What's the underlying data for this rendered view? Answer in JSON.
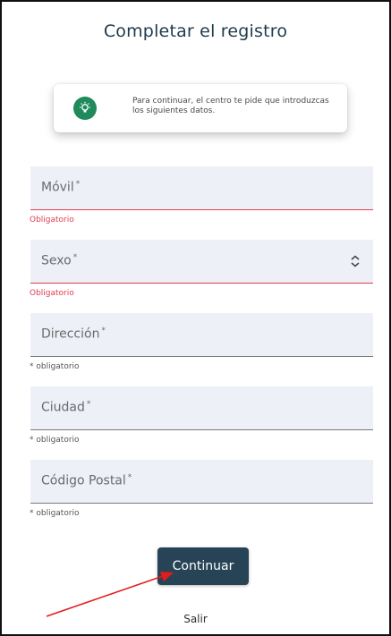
{
  "header": {
    "title": "Completar el registro"
  },
  "notice": {
    "text": "Para continuar, el centro te pide que introduzcas los siguientes datos."
  },
  "fields": [
    {
      "label": "Móvil",
      "required_mark": "*",
      "helper": "Obligatorio",
      "state": "error"
    },
    {
      "label": "Sexo",
      "required_mark": "*",
      "helper": "Obligatorio",
      "state": "error",
      "type": "select"
    },
    {
      "label": "Dirección",
      "required_mark": "*",
      "helper": "* obligatorio",
      "state": "normal"
    },
    {
      "label": "Ciudad",
      "required_mark": "*",
      "helper": "* obligatorio",
      "state": "normal"
    },
    {
      "label": "Código Postal",
      "required_mark": "*",
      "helper": "* obligatorio",
      "state": "normal"
    }
  ],
  "actions": {
    "continue_label": "Continuar",
    "exit_label": "Salir"
  },
  "colors": {
    "primary": "#274457",
    "error": "#e23d50",
    "icon_bg": "#1f8a5b",
    "field_bg": "#eef0f8",
    "annotation_arrow": "#e31b1b"
  }
}
